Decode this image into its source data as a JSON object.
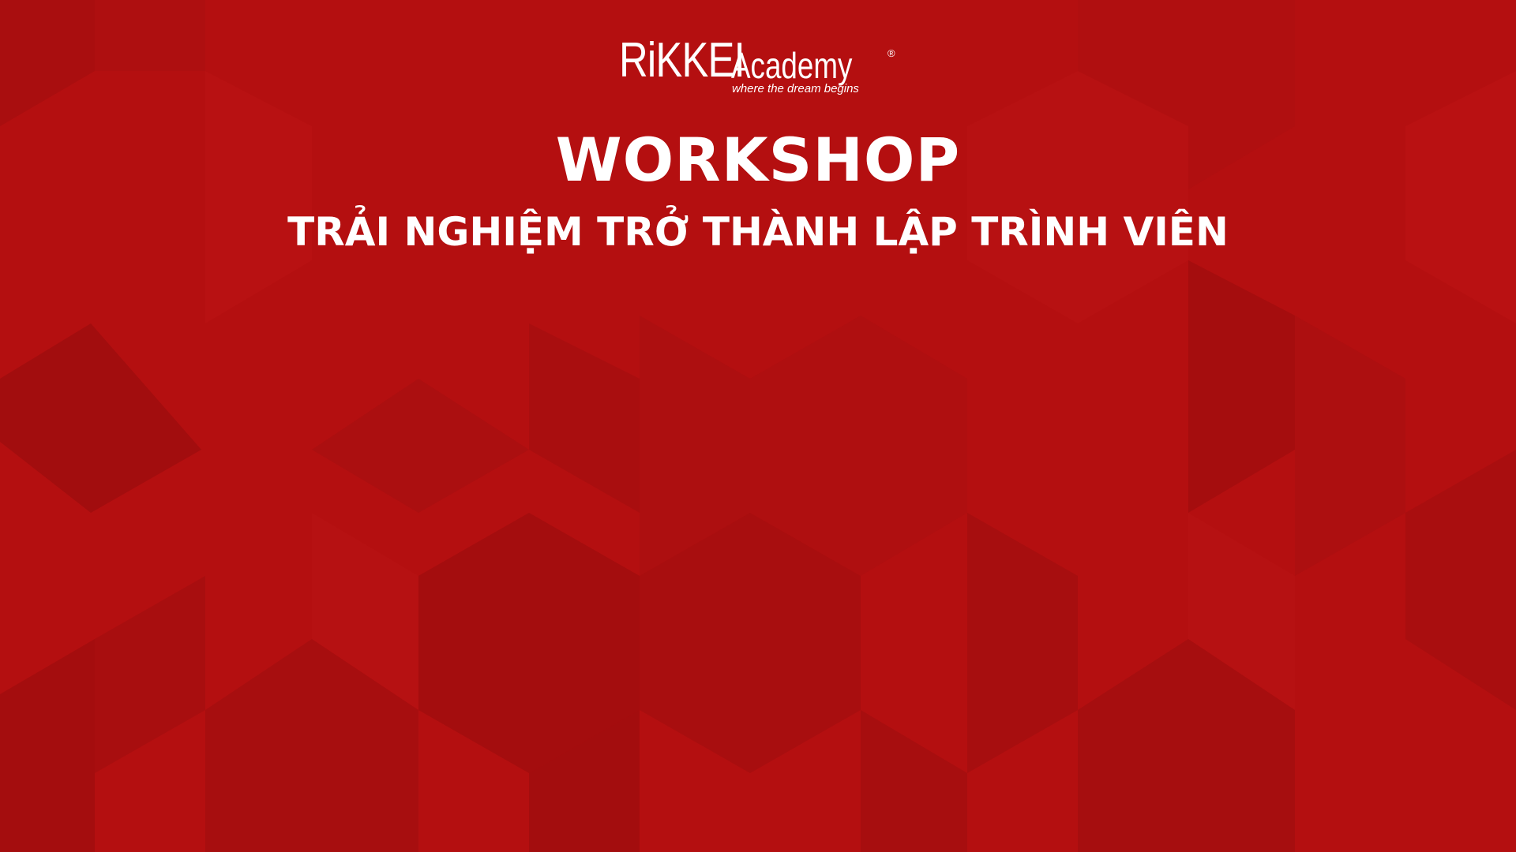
{
  "logo": {
    "wordmark": "RiKKEI",
    "academy": "Academy",
    "registered": "®",
    "tagline": "where the dream begins"
  },
  "title": "WORKSHOP",
  "subtitle": "TRẢI NGHIỆM TRỞ THÀNH LẬP TRÌNH VIÊN",
  "colors": {
    "background": "#b40f10",
    "background_dark": "#a00d0e",
    "text": "#ffffff"
  }
}
